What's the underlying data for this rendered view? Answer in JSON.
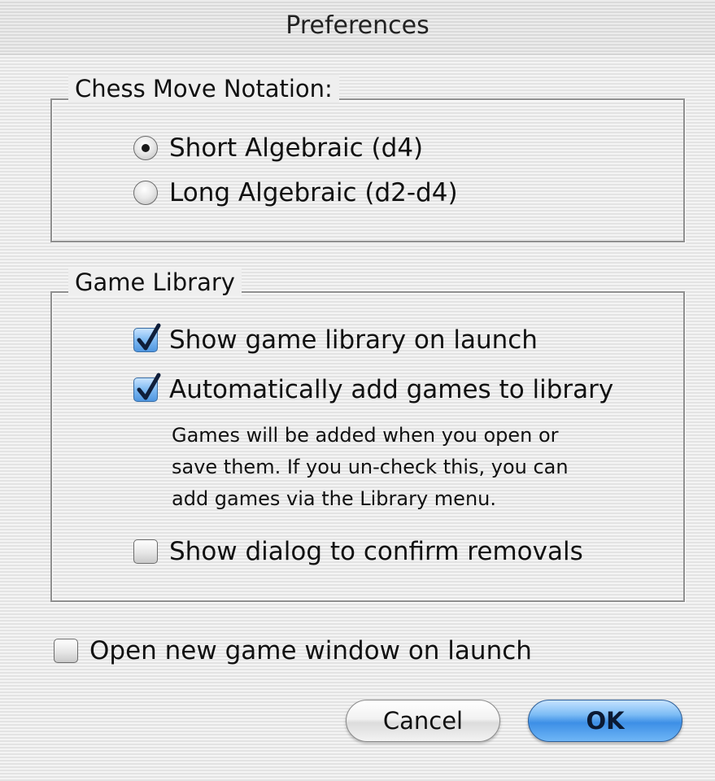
{
  "window": {
    "title": "Preferences"
  },
  "notation": {
    "group_label": "Chess Move Notation:",
    "options": [
      {
        "label": "Short Algebraic (d4)",
        "selected": true
      },
      {
        "label": "Long Algebraic (d2-d4)",
        "selected": false
      }
    ]
  },
  "library": {
    "group_label": "Game Library",
    "show_on_launch": {
      "label": "Show game library on launch",
      "checked": true
    },
    "auto_add": {
      "label": "Automatically add games to library",
      "checked": true
    },
    "help_lines": [
      "Games will be added when you open or",
      "save them.  If you un-check this, you can",
      "add games via the Library menu."
    ],
    "confirm_removals": {
      "label": "Show dialog to confirm removals",
      "checked": false
    }
  },
  "open_new_window": {
    "label": "Open new game window on launch",
    "checked": false
  },
  "buttons": {
    "cancel": "Cancel",
    "ok": "OK"
  },
  "colors": {
    "accent": "#4f96e0",
    "default_button": "#3d8fe6"
  }
}
